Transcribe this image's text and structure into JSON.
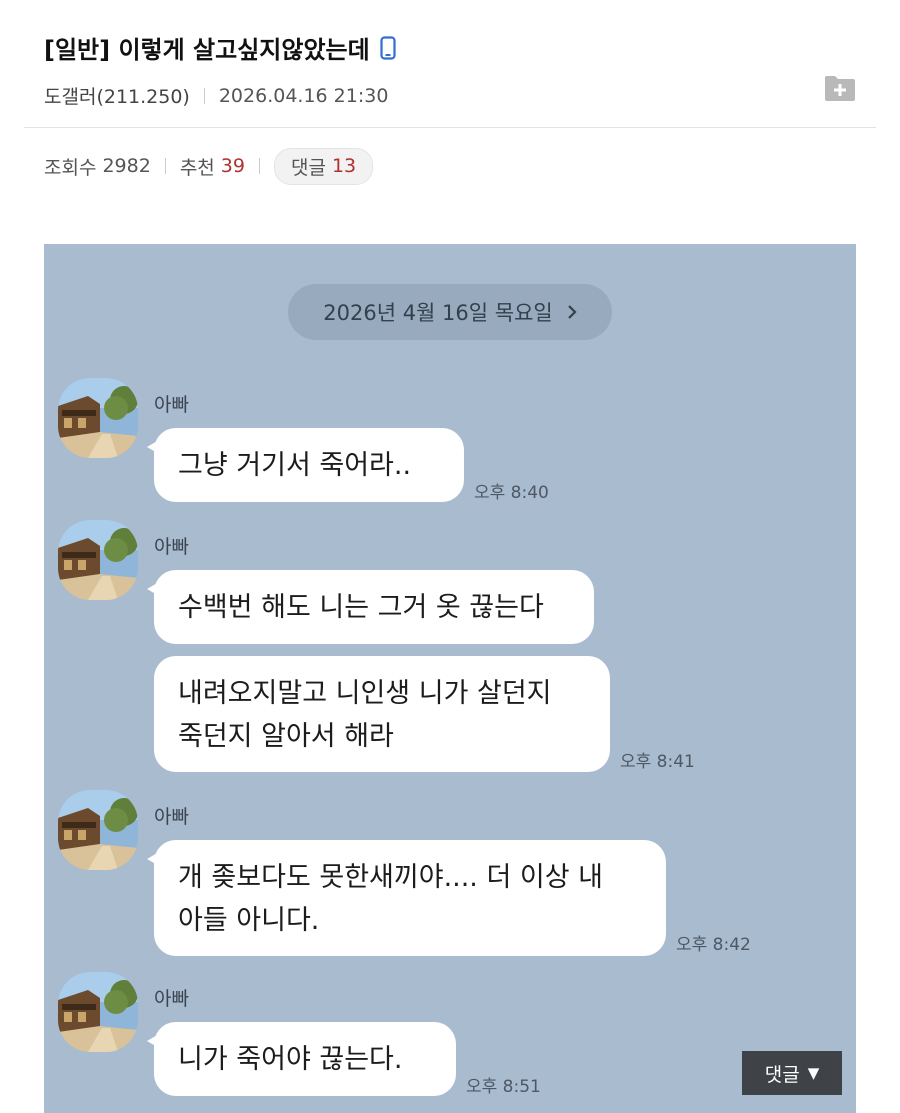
{
  "post": {
    "title": "[일반] 이렇게 살고싶지않았는데",
    "author": "도갤러(211.250)",
    "datetime": "2026.04.16 21:30",
    "views_label": "조회수",
    "views": "2982",
    "recommend_label": "추천",
    "recommend": "39",
    "comments_label": "댓글",
    "comments": "13"
  },
  "chat": {
    "date": "2026년 4월 16일 목요일",
    "messages": [
      {
        "sender": "아빠",
        "lines": [
          "그냥 거기서 죽어라.."
        ],
        "time": "오후 8:40"
      },
      {
        "sender": "아빠",
        "lines": [
          "수백번 해도 니는 그거 옷 끊는다"
        ],
        "time": ""
      },
      {
        "sender": "",
        "lines": [
          "내려오지말고 니인생 니가 살던지",
          "죽던지 알아서 해라"
        ],
        "time": "오후 8:41"
      },
      {
        "sender": "아빠",
        "lines": [
          "개 좆보다도 못한새끼야....  더 이상 내",
          "아들 아니다."
        ],
        "time": "오후 8:42"
      },
      {
        "sender": "아빠",
        "lines": [
          "니가 죽어야 끊는다."
        ],
        "time": "오후 8:51"
      }
    ]
  },
  "footer": {
    "comments_toggle": "댓글",
    "comments_toggle_arrow": "▼"
  },
  "colors": {
    "chat_background": "#a9bbcf",
    "date_pill": "#98aabd",
    "bubble": "#ffffff",
    "count_accent": "#b03030",
    "toggle_background": "#3f4247"
  },
  "icons": [
    "mobile-phone-icon",
    "folder-add-icon",
    "chevron-right-icon",
    "avatar-photo"
  ]
}
